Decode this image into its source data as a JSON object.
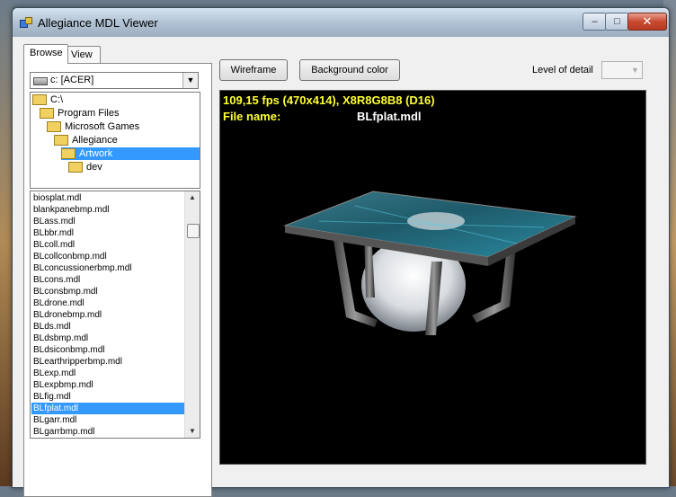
{
  "window": {
    "title": "Allegiance MDL Viewer",
    "controls": {
      "minimize": "–",
      "maximize": "□",
      "close": "✕"
    }
  },
  "tabs": [
    {
      "label": "Browse",
      "active": true
    },
    {
      "label": "View",
      "active": false
    }
  ],
  "drive": {
    "value": "c: [ACER]",
    "icon": "drive-icon"
  },
  "tree": [
    {
      "label": "C:\\",
      "depth": 0,
      "selected": false
    },
    {
      "label": "Program Files",
      "depth": 1,
      "selected": false
    },
    {
      "label": "Microsoft Games",
      "depth": 2,
      "selected": false
    },
    {
      "label": "Allegiance",
      "depth": 3,
      "selected": false
    },
    {
      "label": "Artwork",
      "depth": 4,
      "selected": true
    },
    {
      "label": "dev",
      "depth": 5,
      "selected": false
    }
  ],
  "files": [
    "biosplat.mdl",
    "blankpanebmp.mdl",
    "BLass.mdl",
    "BLbbr.mdl",
    "BLcoll.mdl",
    "BLcollconbmp.mdl",
    "BLconcussionerbmp.mdl",
    "BLcons.mdl",
    "BLconsbmp.mdl",
    "BLdrone.mdl",
    "BLdronebmp.mdl",
    "BLds.mdl",
    "BLdsbmp.mdl",
    "BLdsiconbmp.mdl",
    "BLearthripperbmp.mdl",
    "BLexp.mdl",
    "BLexpbmp.mdl",
    "BLfig.mdl",
    "BLfplat.mdl",
    "BLgarr.mdl",
    "BLgarrbmp.mdl"
  ],
  "selected_file": "BLfplat.mdl",
  "toolbar": {
    "wireframe_label": "Wireframe",
    "background_label": "Background color",
    "lod_label": "Level of detail",
    "lod_value": ""
  },
  "viewport": {
    "fps_text": "109,15 fps (470x414), X8R8G8B8 (D16)",
    "file_name_label": "File name:",
    "file_name_value": "BLfplat.mdl",
    "overlay_color": "#ffff33"
  }
}
